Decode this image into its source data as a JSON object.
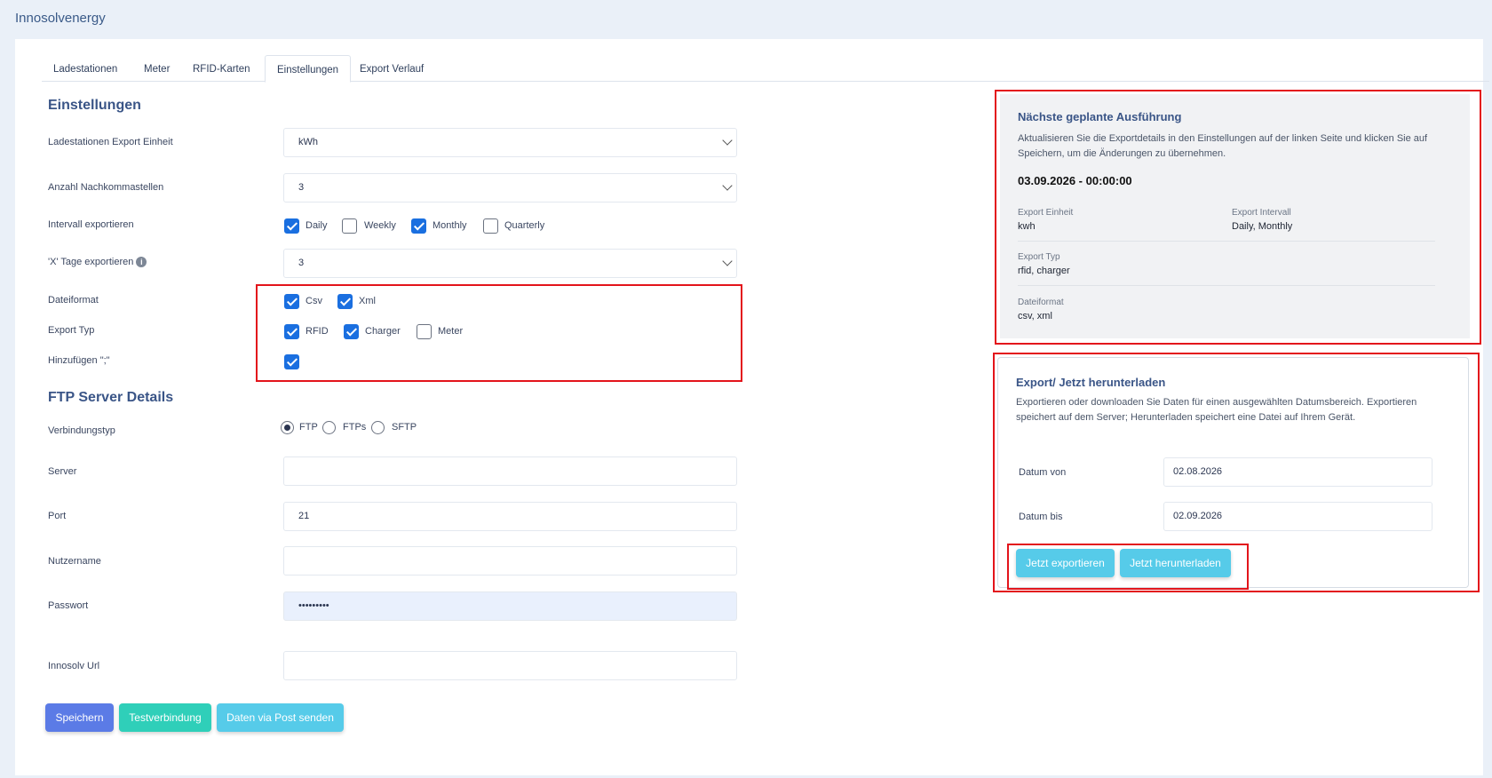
{
  "app": {
    "title": "Innosolvenergy"
  },
  "tabs": [
    {
      "label": "Ladestationen"
    },
    {
      "label": "Meter"
    },
    {
      "label": "RFID-Karten"
    },
    {
      "label": "Einstellungen",
      "active": true
    },
    {
      "label": "Export Verlauf"
    }
  ],
  "settings": {
    "title": "Einstellungen",
    "export_unit": {
      "label": "Ladestationen Export Einheit",
      "value": "kWh"
    },
    "decimals": {
      "label": "Anzahl Nachkommastellen",
      "value": "3"
    },
    "interval": {
      "label": "Intervall exportieren",
      "options": [
        {
          "label": "Daily",
          "checked": true
        },
        {
          "label": "Weekly",
          "checked": false
        },
        {
          "label": "Monthly",
          "checked": true
        },
        {
          "label": "Quarterly",
          "checked": false
        }
      ]
    },
    "x_days": {
      "label": "'X' Tage exportieren",
      "value": "3"
    },
    "file_format": {
      "label": "Dateiformat",
      "options": [
        {
          "label": "Csv",
          "checked": true
        },
        {
          "label": "Xml",
          "checked": true
        }
      ]
    },
    "export_type": {
      "label": "Export Typ",
      "options": [
        {
          "label": "RFID",
          "checked": true
        },
        {
          "label": "Charger",
          "checked": true
        },
        {
          "label": "Meter",
          "checked": false
        }
      ]
    },
    "add_semicolon": {
      "label": "Hinzufügen \";\"",
      "checked": true
    }
  },
  "ftp": {
    "title": "FTP Server Details",
    "connection_type": {
      "label": "Verbindungstyp",
      "options": [
        {
          "label": "FTP",
          "checked": true
        },
        {
          "label": "FTPs",
          "checked": false
        },
        {
          "label": "SFTP",
          "checked": false
        }
      ]
    },
    "server": {
      "label": "Server",
      "value": ""
    },
    "port": {
      "label": "Port",
      "value": "21"
    },
    "username": {
      "label": "Nutzername",
      "value": ""
    },
    "password": {
      "label": "Passwort",
      "value": "•••••••••"
    },
    "url": {
      "label": "Innosolv Url",
      "value": ""
    }
  },
  "actions": {
    "save": "Speichern",
    "test": "Testverbindung",
    "post": "Daten via Post senden"
  },
  "next_run": {
    "title": "Nächste geplante Ausführung",
    "description": "Aktualisieren Sie die Exportdetails in den Einstellungen auf der linken Seite und klicken Sie auf Speichern, um die Änderungen zu übernehmen.",
    "datetime": "03.09.2026 - 00:00:00",
    "export_unit_label": "Export Einheit",
    "export_unit_value": "kwh",
    "export_interval_label": "Export Intervall",
    "export_interval_value": "Daily, Monthly",
    "export_type_label": "Export Typ",
    "export_type_value": "rfid, charger",
    "file_format_label": "Dateiformat",
    "file_format_value": "csv, xml"
  },
  "export_now": {
    "title": "Export/ Jetzt herunterladen",
    "description": "Exportieren oder downloaden Sie Daten für einen ausgewählten Datumsbereich. Exportieren speichert auf dem Server; Herunterladen speichert eine Datei auf Ihrem Gerät.",
    "from_label": "Datum von",
    "from_value": "02.08.2026",
    "to_label": "Datum bis",
    "to_value": "02.09.2026",
    "export_button": "Jetzt exportieren",
    "download_button": "Jetzt herunterladen"
  },
  "colors": {
    "accent_blue": "#1a6fe0",
    "highlight_red": "#e3141b",
    "save_button": "#5b7be6",
    "test_button": "#2fcfb9",
    "post_button": "#56cbe9"
  }
}
